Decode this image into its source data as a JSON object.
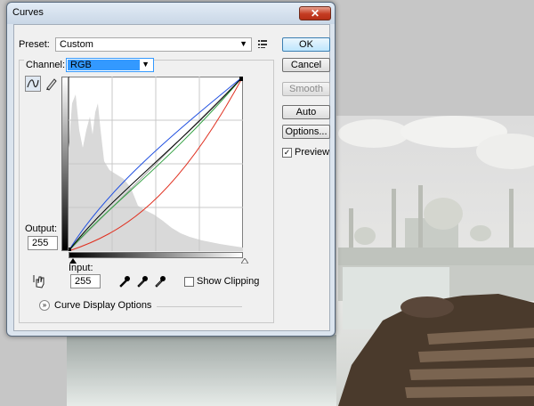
{
  "dialog": {
    "title": "Curves",
    "close_glyph": "✕",
    "preset_label": "Preset:",
    "preset_value": "Custom",
    "channel_label": "Channel:",
    "channel_value": "RGB",
    "output_label": "Output:",
    "output_value": "255",
    "input_label": "Input:",
    "input_value": "255",
    "show_clipping_label": "Show Clipping",
    "show_clipping_checked": false,
    "curve_display_options_label": "Curve Display Options",
    "preview_label": "Preview",
    "preview_checked": true
  },
  "buttons": {
    "ok": "OK",
    "cancel": "Cancel",
    "smooth": "Smooth",
    "auto": "Auto",
    "options": "Options..."
  },
  "icons": {
    "close": "close-icon",
    "preset_menu": "preset-options-icon",
    "curve_tool": "curve-point-icon",
    "pencil_tool": "pencil-icon",
    "hand_tool": "on-image-adjust-icon",
    "black_eyedropper": "black-point-eyedropper-icon",
    "gray_eyedropper": "gray-point-eyedropper-icon",
    "white_eyedropper": "white-point-eyedropper-icon",
    "expand": "chevron-down-icon"
  },
  "colors": {
    "channel_highlight": "#3399ff",
    "curve_red": "#e03020",
    "curve_green": "#30a040",
    "curve_blue": "#2050e0",
    "curve_rgb": "#000000"
  }
}
